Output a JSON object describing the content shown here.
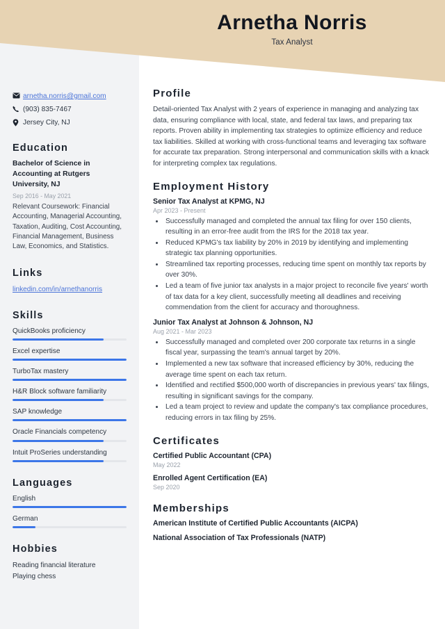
{
  "theme": {
    "banner_color": "#e7d3b3",
    "sidebar_color": "#f2f3f5",
    "link_color": "#4a73d8",
    "meter_color": "#3c76e8",
    "meter_track_color": "#e4e6ea",
    "heading_color": "#1d242f"
  },
  "header": {
    "name": "Arnetha Norris",
    "role": "Tax Analyst"
  },
  "sidebar": {
    "contact": [
      {
        "icon": "envelope-icon",
        "value": "arnetha.norris@gmail.com",
        "is_link": true
      },
      {
        "icon": "phone-icon",
        "value": "(903) 835-7467",
        "is_link": false
      },
      {
        "icon": "location-pin-icon",
        "value": "Jersey City, NJ",
        "is_link": false
      }
    ],
    "education": {
      "heading": "Education",
      "degree": "Bachelor of Science in Accounting at Rutgers University, NJ",
      "dates": "Sep 2016 - May 2021",
      "description": "Relevant Coursework: Financial Accounting, Managerial Accounting, Taxation, Auditing, Cost Accounting, Financial Management, Business Law, Economics, and Statistics."
    },
    "links": {
      "heading": "Links",
      "items": [
        {
          "label": "linkedin.com/in/arnethanorris"
        }
      ]
    },
    "skills": {
      "heading": "Skills",
      "items": [
        {
          "label": "QuickBooks proficiency",
          "level": 80
        },
        {
          "label": "Excel expertise",
          "level": 100
        },
        {
          "label": "TurboTax mastery",
          "level": 100
        },
        {
          "label": "H&R Block software familiarity",
          "level": 80
        },
        {
          "label": "SAP knowledge",
          "level": 100
        },
        {
          "label": "Oracle Financials competency",
          "level": 80
        },
        {
          "label": "Intuit ProSeries understanding",
          "level": 80
        }
      ]
    },
    "languages": {
      "heading": "Languages",
      "items": [
        {
          "label": "English",
          "level": 100
        },
        {
          "label": "German",
          "level": 20
        }
      ]
    },
    "hobbies": {
      "heading": "Hobbies",
      "items": [
        {
          "label": "Reading financial literature"
        },
        {
          "label": "Playing chess"
        }
      ]
    }
  },
  "main": {
    "profile": {
      "heading": "Profile",
      "text": "Detail-oriented Tax Analyst with 2 years of experience in managing and analyzing tax data, ensuring compliance with local, state, and federal tax laws, and preparing tax reports. Proven ability in implementing tax strategies to optimize efficiency and reduce tax liabilities. Skilled at working with cross-functional teams and leveraging tax software for accurate tax preparation. Strong interpersonal and communication skills with a knack for interpreting complex tax regulations."
    },
    "employment": {
      "heading": "Employment History",
      "jobs": [
        {
          "title": "Senior Tax Analyst at KPMG, NJ",
          "dates": "Apr 2023 - Present",
          "bullets": [
            "Successfully managed and completed the annual tax filing for over 150 clients, resulting in an error-free audit from the IRS for the 2018 tax year.",
            "Reduced KPMG's tax liability by 20% in 2019 by identifying and implementing strategic tax planning opportunities.",
            "Streamlined tax reporting processes, reducing time spent on monthly tax reports by over 30%.",
            "Led a team of five junior tax analysts in a major project to reconcile five years' worth of tax data for a key client, successfully meeting all deadlines and receiving commendation from the client for accuracy and thoroughness."
          ]
        },
        {
          "title": "Junior Tax Analyst at Johnson & Johnson, NJ",
          "dates": "Aug 2021 - Mar 2023",
          "bullets": [
            "Successfully managed and completed over 200 corporate tax returns in a single fiscal year, surpassing the team's annual target by 20%.",
            "Implemented a new tax software that increased efficiency by 30%, reducing the average time spent on each tax return.",
            "Identified and rectified $500,000 worth of discrepancies in previous years' tax filings, resulting in significant savings for the company.",
            "Led a team project to review and update the company's tax compliance procedures, reducing errors in tax filing by 25%."
          ]
        }
      ]
    },
    "certificates": {
      "heading": "Certificates",
      "items": [
        {
          "name": "Certified Public Accountant (CPA)",
          "date": "May 2022"
        },
        {
          "name": "Enrolled Agent Certification (EA)",
          "date": "Sep 2020"
        }
      ]
    },
    "memberships": {
      "heading": "Memberships",
      "items": [
        {
          "name": "American Institute of Certified Public Accountants (AICPA)"
        },
        {
          "name": "National Association of Tax Professionals (NATP)"
        }
      ]
    }
  }
}
